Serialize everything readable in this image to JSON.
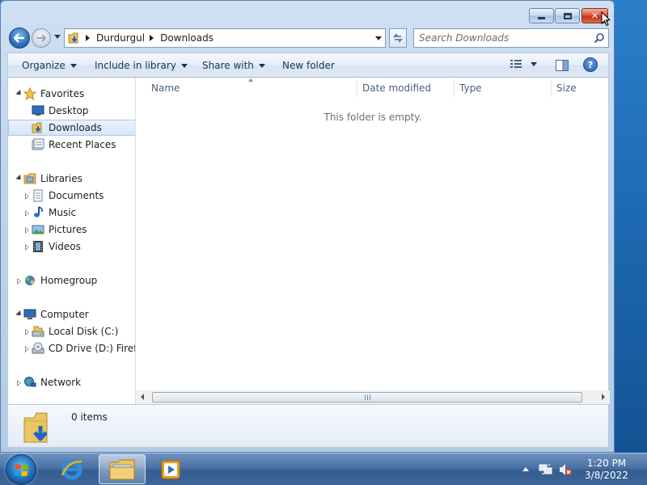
{
  "window": {
    "title_buttons": {
      "minimize": "minimize",
      "maximize": "maximize",
      "close": "close"
    }
  },
  "address": {
    "crumbs": [
      "Durdurgul",
      "Downloads"
    ],
    "search_placeholder": "Search Downloads"
  },
  "toolbar": {
    "organize": "Organize",
    "include_in_library": "Include in library",
    "share_with": "Share with",
    "new_folder": "New folder"
  },
  "nav": {
    "favorites": "Favorites",
    "desktop": "Desktop",
    "downloads": "Downloads",
    "recent_places": "Recent Places",
    "libraries": "Libraries",
    "documents": "Documents",
    "music": "Music",
    "pictures": "Pictures",
    "videos": "Videos",
    "homegroup": "Homegroup",
    "computer": "Computer",
    "local_disk": "Local Disk (C:)",
    "cd_drive": "CD Drive (D:) Firefox",
    "network": "Network"
  },
  "filelist": {
    "columns": [
      "Name",
      "Date modified",
      "Type",
      "Size"
    ],
    "empty_message": "This folder is empty."
  },
  "details": {
    "item_count": "0 items"
  },
  "taskbar": {
    "time": "1:20 PM",
    "date": "3/8/2022"
  },
  "colors": {
    "desktop": "#1a62aa",
    "window_frame": "#bfd4ec",
    "close_button": "#c3351c",
    "selection": "#d4e5fa",
    "taskbar": "#4a71a3"
  }
}
